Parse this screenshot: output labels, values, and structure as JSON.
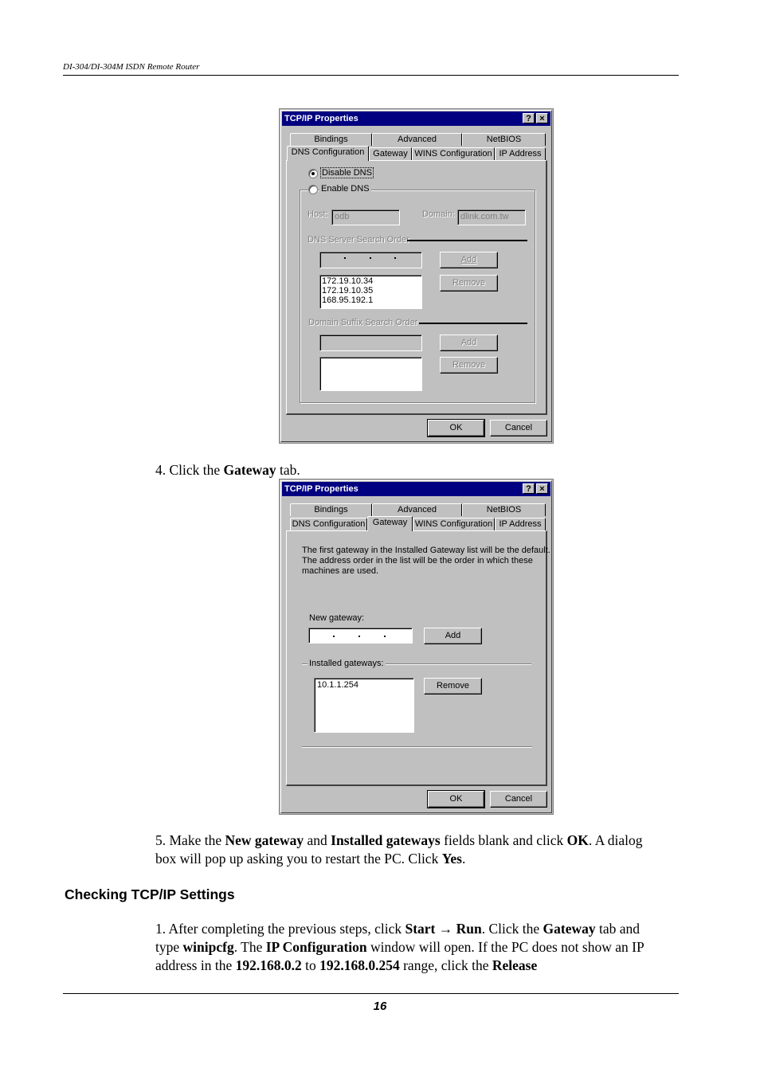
{
  "page": {
    "running_head": "DI-304/DI-304M ISDN Remote Router",
    "page_number": "16"
  },
  "dialog1": {
    "title": "TCP/IP Properties",
    "help_button": "?",
    "close_button": "×",
    "tabs_row1": [
      "Bindings",
      "Advanced",
      "NetBIOS"
    ],
    "tabs_row2": [
      "DNS Configuration",
      "Gateway",
      "WINS Configuration",
      "IP Address"
    ],
    "active_tab": "DNS Configuration",
    "radio_disable": "Disable DNS",
    "radio_enable": "Enable DNS",
    "selected_radio": "Disable DNS",
    "host_label": "Host:",
    "host_value": "odb",
    "domain_label": "Domain:",
    "domain_value": "dlink.com.tw",
    "dns_order_label": "DNS Server Search Order",
    "dns_add": "Add",
    "dns_remove": "Remove",
    "dns_servers": [
      "172.19.10.34",
      "172.19.10.35",
      "168.95.192.1"
    ],
    "suffix_label": "Domain Suffix Search Order",
    "suffix_add": "Add",
    "suffix_remove": "Remove",
    "ok": "OK",
    "cancel": "Cancel"
  },
  "step4": {
    "prefix": "4. Click the ",
    "bold": "Gateway",
    "suffix": " tab."
  },
  "dialog2": {
    "title": "TCP/IP Properties",
    "help_button": "?",
    "close_button": "×",
    "tabs_row1": [
      "Bindings",
      "Advanced",
      "NetBIOS"
    ],
    "tabs_row2": [
      "DNS Configuration",
      "Gateway",
      "WINS Configuration",
      "IP Address"
    ],
    "active_tab": "Gateway",
    "info_line1": "The first gateway in the Installed Gateway list will be the default.",
    "info_line2": "The address order in the list will be the order in which these",
    "info_line3": "machines are used.",
    "new_gateway_label": "New gateway:",
    "add": "Add",
    "installed_label": "Installed gateways:",
    "installed_gateways": [
      "10.1.1.254"
    ],
    "remove": "Remove",
    "ok": "OK",
    "cancel": "Cancel"
  },
  "step5": {
    "t1": "5. Make the ",
    "b1": "New gateway",
    "t2": " and ",
    "b2": "Installed gateways",
    "t3": " fields blank and click ",
    "b3": "OK",
    "t4": ". A dialog box will pop up asking you to restart the PC. Click ",
    "b4": "Yes",
    "t5": "."
  },
  "section": {
    "heading": "Checking TCP/IP Settings"
  },
  "step1": {
    "t1": "1. After completing the previous steps, click ",
    "b1": "Start",
    "arrow": " → ",
    "b2": "Run",
    "t2": ". Click the ",
    "b3": "Gateway",
    "t3": " tab and type ",
    "b4": "winipcfg",
    "t4": ". The ",
    "b5": "IP Configuration",
    "t5": " window will open. If the PC does not show an IP address in the ",
    "b6": "192.168.0.2",
    "t6": " to ",
    "b7": "192.168.0.254",
    "t7": " range, click the ",
    "b8": "Release"
  }
}
